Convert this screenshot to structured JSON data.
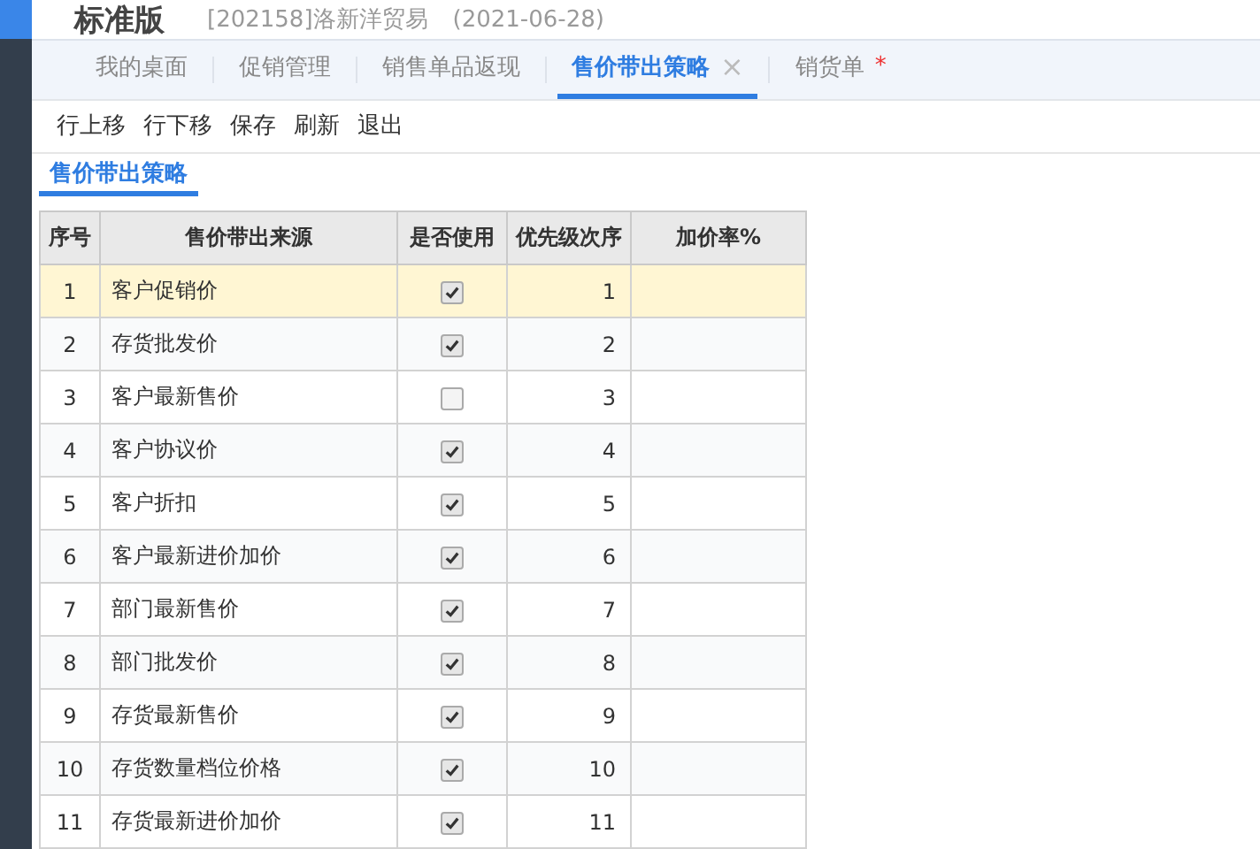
{
  "header": {
    "product": "标准版",
    "company": "[202158]洛新洋贸易",
    "date": "(2021-06-28)"
  },
  "tabs": [
    {
      "label": "我的桌面",
      "selected": false
    },
    {
      "label": "促销管理",
      "selected": false
    },
    {
      "label": "销售单品返现",
      "selected": false
    },
    {
      "label": "售价带出策略",
      "selected": true,
      "close": "×"
    },
    {
      "label": "销货单",
      "selected": false,
      "modified_mark": "*"
    }
  ],
  "toolbar": [
    "行上移",
    "行下移",
    "保存",
    "刷新",
    "退出"
  ],
  "section_title": "售价带出策略",
  "table": {
    "columns": [
      "序号",
      "售价带出来源",
      "是否使用",
      "优先级次序",
      "加价率%"
    ],
    "rows": [
      {
        "index": "1",
        "source": "客户促销价",
        "used": true,
        "priority": "1",
        "selected": true
      },
      {
        "index": "2",
        "source": "存货批发价",
        "used": true,
        "priority": "2",
        "selected": false
      },
      {
        "index": "3",
        "source": "客户最新售价",
        "used": false,
        "priority": "3",
        "selected": false
      },
      {
        "index": "4",
        "source": "客户协议价",
        "used": true,
        "priority": "4",
        "selected": false
      },
      {
        "index": "5",
        "source": "客户折扣",
        "used": true,
        "priority": "5",
        "selected": false
      },
      {
        "index": "6",
        "source": "客户最新进价加价",
        "used": true,
        "priority": "6",
        "selected": false
      },
      {
        "index": "7",
        "source": "部门最新售价",
        "used": true,
        "priority": "7",
        "selected": false
      },
      {
        "index": "8",
        "source": "部门批发价",
        "used": true,
        "priority": "8",
        "selected": false
      },
      {
        "index": "9",
        "source": "存货最新售价",
        "used": true,
        "priority": "9",
        "selected": false
      },
      {
        "index": "10",
        "source": "存货数量档位价格",
        "used": true,
        "priority": "10",
        "selected": false
      },
      {
        "index": "11",
        "source": "存货最新进价加价",
        "used": true,
        "priority": "11",
        "selected": false
      }
    ]
  }
}
